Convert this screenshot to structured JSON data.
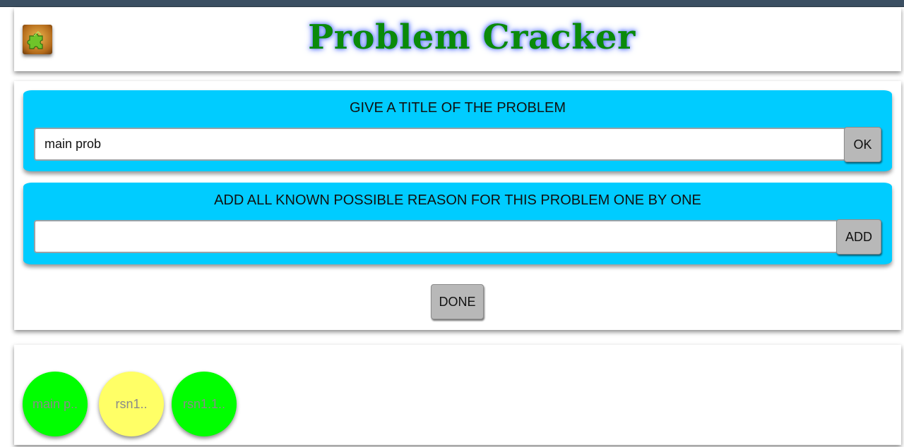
{
  "app": {
    "title": "Problem Cracker",
    "logo_icon": "puzzle-piece-icon"
  },
  "title_panel": {
    "heading": "GIVE A TITLE OF THE PROBLEM",
    "input_value": "main prob",
    "ok_label": "OK"
  },
  "reason_panel": {
    "heading": "ADD ALL KNOWN POSSIBLE REASON FOR THIS PROBLEM ONE BY ONE",
    "input_value": "",
    "add_label": "ADD"
  },
  "done_label": "DONE",
  "nodes": [
    {
      "label": "main p..",
      "color": "#00ff00"
    },
    {
      "label": "rsn1..",
      "color": "#ffff66"
    },
    {
      "label": "rsn1.1..",
      "color": "#00ff00"
    }
  ],
  "colors": {
    "topbar": "#3b4f62",
    "panel": "#00ccff",
    "title_text": "#0a8a0a",
    "title_glow": "#5570ff",
    "button": "#b8b8b8"
  }
}
